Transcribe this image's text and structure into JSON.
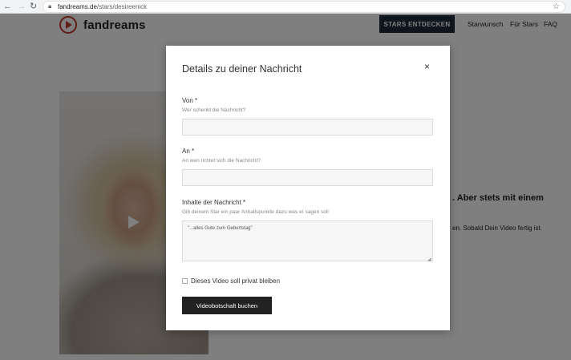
{
  "browser": {
    "back_icon": "arrow-left-icon",
    "forward_icon": "arrow-right-icon",
    "reload_icon": "reload-icon",
    "url_host": "fandreams.de",
    "url_path": "/stars/desireenick"
  },
  "header": {
    "logo_text": "fandreams",
    "cta_label": "STARS ENTDECKEN",
    "nav": [
      "Starwunsch",
      "Für Stars",
      "FAQ"
    ],
    "brand_color": "#c0392b",
    "cta_color": "#1d2a3a"
  },
  "background": {
    "headline_fragment": ". Aber stets mit einem",
    "text_fragment": "en. Sobald Dein Video fertig ist."
  },
  "modal": {
    "title": "Details zu deiner Nachricht",
    "close_label": "×",
    "fields": [
      {
        "label": "Von *",
        "hint": "Wer schenkt die Nachricht?",
        "value": ""
      },
      {
        "label": "An *",
        "hint": "An wen richtet sich die Nachricht?",
        "value": ""
      },
      {
        "label": "Inhalte der Nachricht *",
        "hint": "Gib deinem Star ein paar Anhaltspunkte dazu was er sagen soll",
        "placeholder": "\"...alles Gute zum Geburtstag\""
      }
    ],
    "checkbox_label": "Dieses Video soll privat bleiben",
    "checkbox_checked": false,
    "submit_label": "Videobotschaft buchen"
  }
}
